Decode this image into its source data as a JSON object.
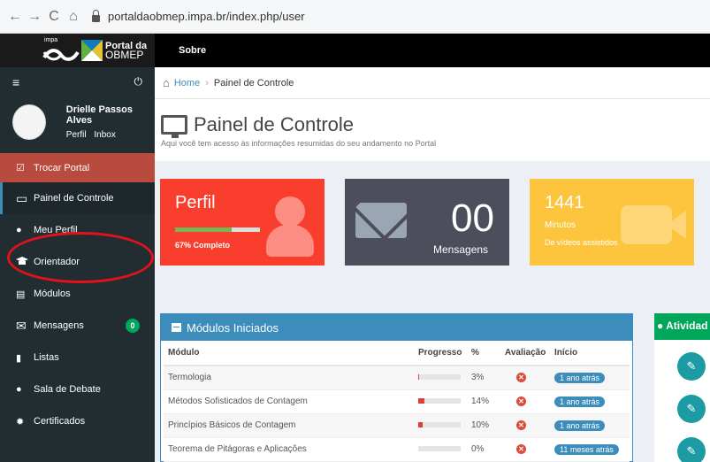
{
  "browser": {
    "url": "portaldaobmep.impa.br/index.php/user",
    "back_icon": "arrow-left-icon",
    "forward_icon": "arrow-right-icon",
    "reload_icon": "reload-icon",
    "home_icon": "home-icon"
  },
  "header": {
    "impa_label": "impa",
    "portal_line1": "Portal da",
    "portal_line2": "OBMEP",
    "nav_sobre": "Sobre"
  },
  "sidebar": {
    "toggle_icon": "≡",
    "power_icon": "⏻",
    "user_name": "Drielle Passos Alves",
    "profile_link": "Perfil",
    "inbox_link": "Inbox",
    "items": [
      {
        "label": "Trocar Portal",
        "icon": "☑"
      },
      {
        "label": "Painel de Controle",
        "icon": "▭"
      },
      {
        "label": "Meu Perfil",
        "icon": "●"
      },
      {
        "label": "Orientador",
        "icon": "🎓"
      },
      {
        "label": "Módulos",
        "icon": "▤"
      },
      {
        "label": "Mensagens",
        "icon": "✉",
        "badge": "0"
      },
      {
        "label": "Listas",
        "icon": "▮"
      },
      {
        "label": "Sala de Debate",
        "icon": "●"
      },
      {
        "label": "Certificados",
        "icon": "✹"
      }
    ]
  },
  "breadcrumb": {
    "home": "Home",
    "sep": "›",
    "current": "Painel de Controle"
  },
  "page": {
    "title": "Painel de Controle",
    "subtitle": "Aqui você tem acesso às informações resumidas do seu andamento no Portal"
  },
  "cards": {
    "perfil": {
      "title": "Perfil",
      "progress_percent": 67,
      "caption": "67% Completo"
    },
    "mensagens": {
      "count": "00",
      "label": "Mensagens"
    },
    "minutos": {
      "value": "1441",
      "label": "Minutos",
      "caption": "De vídeos assistidos"
    }
  },
  "modulos_panel": {
    "title": "Módulos Iniciados",
    "columns": [
      "Módulo",
      "Progresso",
      "%",
      "Avaliação",
      "Início"
    ],
    "rows": [
      {
        "modulo": "Termologia",
        "progress": 3,
        "pct": "3%",
        "inicio": "1 ano atrás"
      },
      {
        "modulo": "Métodos Sofisticados de Contagem",
        "progress": 14,
        "pct": "14%",
        "inicio": "1 ano atrás"
      },
      {
        "modulo": "Princípios Básicos de Contagem",
        "progress": 10,
        "pct": "10%",
        "inicio": "1 ano atrás"
      },
      {
        "modulo": "Teorema de Pitágoras e Aplicações",
        "progress": 0,
        "pct": "0%",
        "inicio": "11 meses atrás"
      }
    ]
  },
  "atividades_panel": {
    "title": "Atividad"
  }
}
